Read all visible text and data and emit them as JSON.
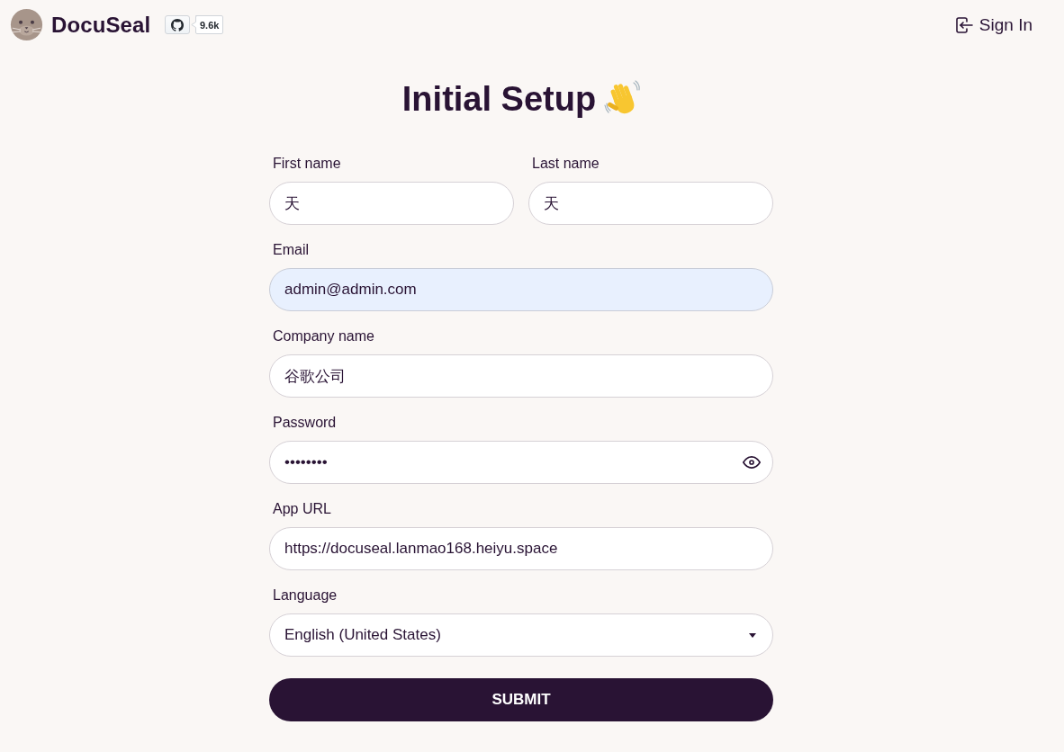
{
  "header": {
    "brand": "DocuSeal",
    "github": {
      "count": "9.6k"
    },
    "sign_in": "Sign In"
  },
  "title": "Initial Setup",
  "rows": [
    {
      "fields": [
        {
          "kind": "text",
          "label": "First name",
          "value": "天",
          "autofilled": false
        },
        {
          "kind": "text",
          "label": "Last name",
          "value": "天",
          "autofilled": false
        }
      ]
    },
    {
      "fields": [
        {
          "kind": "text",
          "label": "Email",
          "value": "admin@admin.com",
          "autofilled": true
        }
      ]
    },
    {
      "fields": [
        {
          "kind": "text",
          "label": "Company name",
          "value": "谷歌公司",
          "autofilled": false
        }
      ]
    },
    {
      "fields": [
        {
          "kind": "password",
          "label": "Password",
          "value": "••••••••",
          "autofilled": false
        }
      ]
    },
    {
      "fields": [
        {
          "kind": "text",
          "label": "App URL",
          "value": "https://docuseal.lanmao168.heiyu.space",
          "autofilled": false
        }
      ]
    },
    {
      "fields": [
        {
          "kind": "select",
          "label": "Language",
          "value": "English (United States)",
          "autofilled": false
        }
      ]
    }
  ],
  "submit": "SUBMIT"
}
